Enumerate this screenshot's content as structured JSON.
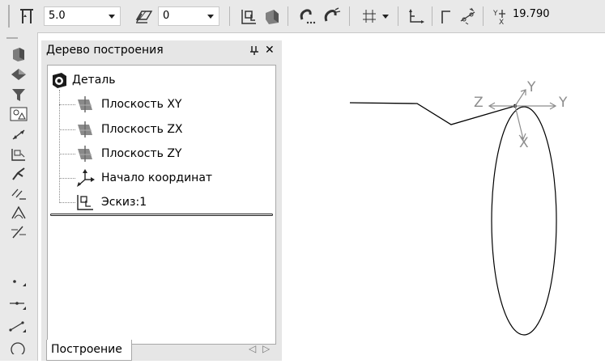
{
  "toolbar": {
    "line_width_value": "5.0",
    "layer_value": "0",
    "coordinate_readout": "19.790",
    "coordinate_axis_label": "Y X"
  },
  "left_toolbar": {
    "icons": [
      "solid-view-icon",
      "extrude-icon",
      "filter-icon",
      "measure-icon",
      "dimension-icon",
      "sketch-icon",
      "operation-icon",
      "constraint-icon",
      "angle-icon",
      "parameters-icon",
      "point-icon",
      "line-icon",
      "segment-icon",
      "circle-icon"
    ]
  },
  "panel": {
    "title": "Дерево построения",
    "pin_glyph": "ᵖ",
    "close_glyph": "✕",
    "root_label": "Деталь",
    "items": [
      {
        "label": "Плоскость XY",
        "icon": "plane-icon"
      },
      {
        "label": "Плоскость ZX",
        "icon": "plane-icon"
      },
      {
        "label": "Плоскость ZY",
        "icon": "plane-icon"
      },
      {
        "label": "Начало координат",
        "icon": "origin-icon"
      },
      {
        "label": "Эскиз:1",
        "icon": "sketch-icon"
      }
    ],
    "tab_label": "Построение",
    "tab_nav_left": "◁",
    "tab_nav_right": "▷"
  },
  "canvas": {
    "axis_labels": {
      "z": "Z",
      "y_upper": "Y",
      "y_right": "Y",
      "x": "X"
    }
  },
  "colors": {
    "toolbar_bg": "#e9e9e9",
    "panel_bg": "#e6e6e6",
    "accent_blue": "#3a5fa0",
    "icon_gray": "#777777"
  }
}
